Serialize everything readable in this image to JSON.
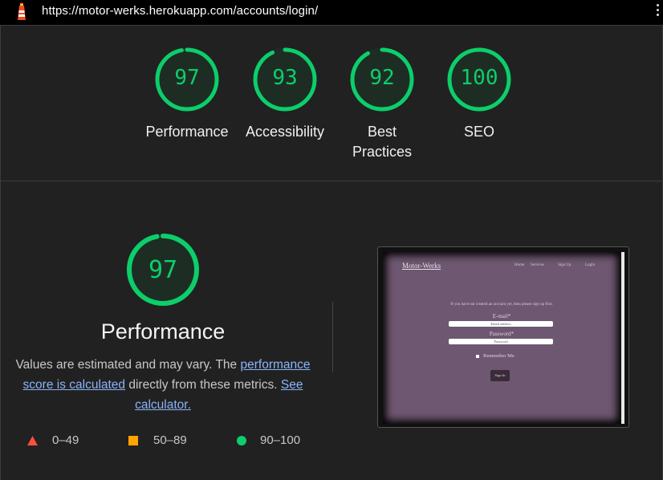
{
  "browser": {
    "url": "https://motor-werks.herokuapp.com/accounts/login/",
    "logo_icon": "lighthouse-icon",
    "menu_icon": "kebab-menu-icon"
  },
  "colors": {
    "pass_green": "#0cce6b",
    "average_orange": "#ffa400",
    "fail_red": "#ff4e42",
    "link_blue": "#8ab4f8"
  },
  "summary": {
    "gauges": [
      {
        "label": "Performance",
        "score": "97",
        "score_value": 97
      },
      {
        "label": "Accessibility",
        "score": "93",
        "score_value": 93
      },
      {
        "label": "Best Practices",
        "label_line1": "Best",
        "label_line2": "Practices",
        "score": "92",
        "score_value": 92
      },
      {
        "label": "SEO",
        "score": "100",
        "score_value": 100
      }
    ]
  },
  "performance": {
    "score": "97",
    "score_value": 97,
    "title": "Performance",
    "desc_part1": "Values are estimated and may vary. The ",
    "desc_link1": "performance score is calculated",
    "desc_part2": " directly from these metrics. ",
    "desc_link2": "See calculator.",
    "legend": [
      {
        "shape": "triangle",
        "range": "0–49"
      },
      {
        "shape": "square",
        "range": "50–89"
      },
      {
        "shape": "circle",
        "range": "90–100"
      }
    ]
  },
  "screenshot": {
    "brand": "Motor-Werks",
    "nav": [
      "Home",
      "Services",
      "Sign Up",
      "Login"
    ],
    "notice": "If you have not created an account yet, then please sign up first.",
    "email_label": "E-mail*",
    "email_placeholder": "Email address",
    "password_label": "Password*",
    "password_placeholder": "Password",
    "remember": "Remember Me",
    "signin": "Sign In"
  }
}
